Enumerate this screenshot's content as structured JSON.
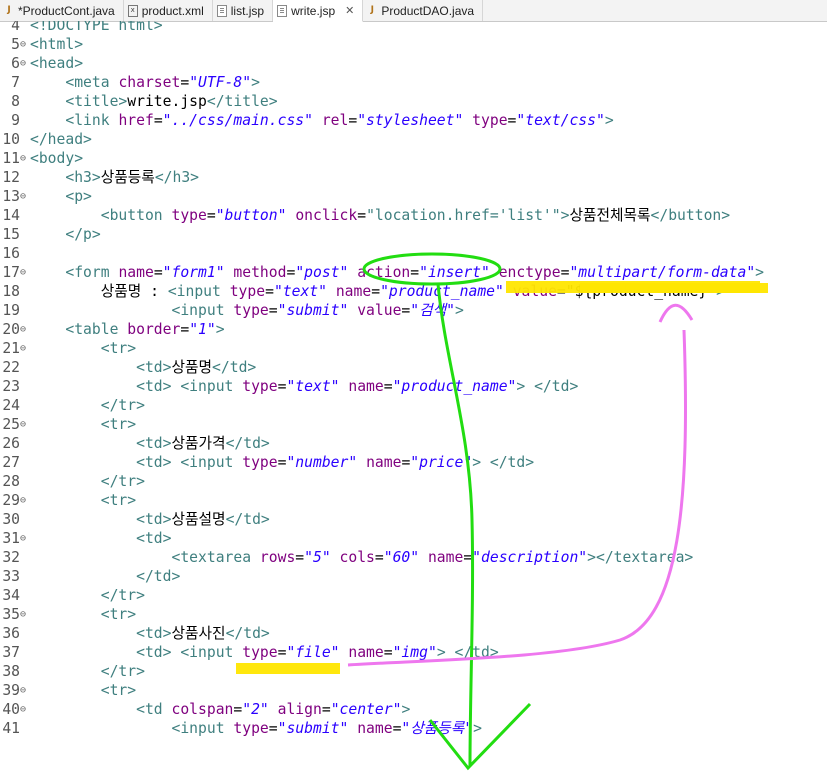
{
  "tabs": [
    {
      "label": "*ProductCont.java",
      "icon": "java-file-icon",
      "active": false
    },
    {
      "label": "product.xml",
      "icon": "xml-file-icon",
      "active": false
    },
    {
      "label": "list.jsp",
      "icon": "jsp-file-icon",
      "active": false
    },
    {
      "label": "write.jsp",
      "icon": "jsp-file-icon",
      "active": true,
      "close": "✕"
    },
    {
      "label": "ProductDAO.java",
      "icon": "java-file-icon",
      "active": false
    }
  ],
  "code_lines": [
    {
      "n": "4",
      "fold": false,
      "parts": [
        [
          "t",
          "<!DOCTYPE html>"
        ]
      ]
    },
    {
      "n": "5",
      "fold": true,
      "parts": [
        [
          "t",
          "<html>"
        ]
      ]
    },
    {
      "n": "6",
      "fold": true,
      "parts": [
        [
          "t",
          "<head>"
        ]
      ]
    },
    {
      "n": "7",
      "fold": false,
      "parts": [
        [
          "k",
          "    "
        ],
        [
          "t",
          "<meta "
        ],
        [
          "a",
          "charset"
        ],
        [
          "k",
          "="
        ],
        [
          "v",
          "\"UTF-8\""
        ],
        [
          "t",
          ">"
        ]
      ]
    },
    {
      "n": "8",
      "fold": false,
      "parts": [
        [
          "k",
          "    "
        ],
        [
          "t",
          "<title>"
        ],
        [
          "k",
          "write.jsp"
        ],
        [
          "t",
          "</title>"
        ]
      ]
    },
    {
      "n": "9",
      "fold": false,
      "parts": [
        [
          "k",
          "    "
        ],
        [
          "t",
          "<link "
        ],
        [
          "a",
          "href"
        ],
        [
          "k",
          "="
        ],
        [
          "v",
          "\"../css/main.css\""
        ],
        [
          "k",
          " "
        ],
        [
          "a",
          "rel"
        ],
        [
          "k",
          "="
        ],
        [
          "v",
          "\"stylesheet\""
        ],
        [
          "k",
          " "
        ],
        [
          "a",
          "type"
        ],
        [
          "k",
          "="
        ],
        [
          "v",
          "\"text/css\""
        ],
        [
          "t",
          ">"
        ]
      ]
    },
    {
      "n": "10",
      "fold": false,
      "parts": [
        [
          "t",
          "</head>"
        ]
      ]
    },
    {
      "n": "11",
      "fold": true,
      "parts": [
        [
          "t",
          "<body>"
        ]
      ]
    },
    {
      "n": "12",
      "fold": false,
      "parts": [
        [
          "k",
          "    "
        ],
        [
          "t",
          "<h3>"
        ],
        [
          "k",
          "상품등록"
        ],
        [
          "t",
          "</h3>"
        ]
      ]
    },
    {
      "n": "13",
      "fold": true,
      "parts": [
        [
          "k",
          "    "
        ],
        [
          "t",
          "<p>"
        ]
      ]
    },
    {
      "n": "14",
      "fold": false,
      "parts": [
        [
          "k",
          "        "
        ],
        [
          "t",
          "<button "
        ],
        [
          "a",
          "type"
        ],
        [
          "k",
          "="
        ],
        [
          "v",
          "\"button\""
        ],
        [
          "k",
          " "
        ],
        [
          "a",
          "onclick"
        ],
        [
          "k",
          "="
        ],
        [
          "t",
          "\"location.href='list'\""
        ],
        [
          "t",
          ">"
        ],
        [
          "k",
          "상품전체목록"
        ],
        [
          "t",
          "</button>"
        ]
      ]
    },
    {
      "n": "15",
      "fold": false,
      "parts": [
        [
          "k",
          "    "
        ],
        [
          "t",
          "</p>"
        ]
      ]
    },
    {
      "n": "16",
      "fold": false,
      "parts": [
        [
          "k",
          ""
        ]
      ]
    },
    {
      "n": "17",
      "fold": true,
      "parts": [
        [
          "k",
          "    "
        ],
        [
          "t",
          "<form "
        ],
        [
          "a",
          "name"
        ],
        [
          "k",
          "="
        ],
        [
          "v",
          "\"form1\""
        ],
        [
          "k",
          " "
        ],
        [
          "a",
          "method"
        ],
        [
          "k",
          "="
        ],
        [
          "v",
          "\"post\""
        ],
        [
          "k",
          " "
        ],
        [
          "a",
          "action"
        ],
        [
          "k",
          "="
        ],
        [
          "v",
          "\"insert\""
        ],
        [
          "k",
          " "
        ],
        [
          "a",
          "enctype"
        ],
        [
          "k",
          "="
        ],
        [
          "v",
          "\"multipart/form-data\""
        ],
        [
          "t",
          ">"
        ]
      ]
    },
    {
      "n": "18",
      "fold": false,
      "parts": [
        [
          "k",
          "        상품명 : "
        ],
        [
          "t",
          "<input "
        ],
        [
          "a",
          "type"
        ],
        [
          "k",
          "="
        ],
        [
          "v",
          "\"text\""
        ],
        [
          "k",
          " "
        ],
        [
          "a",
          "name"
        ],
        [
          "k",
          "="
        ],
        [
          "v",
          "\"product_name\""
        ],
        [
          "k",
          " "
        ],
        [
          "a",
          "value"
        ],
        [
          "k",
          "="
        ],
        [
          "k",
          "\"${product_name}\""
        ],
        [
          "t",
          ">"
        ]
      ]
    },
    {
      "n": "19",
      "fold": false,
      "parts": [
        [
          "k",
          "                "
        ],
        [
          "t",
          "<input "
        ],
        [
          "a",
          "type"
        ],
        [
          "k",
          "="
        ],
        [
          "v",
          "\"submit\""
        ],
        [
          "k",
          " "
        ],
        [
          "a",
          "value"
        ],
        [
          "k",
          "="
        ],
        [
          "v",
          "\"검색\""
        ],
        [
          "t",
          ">"
        ]
      ]
    },
    {
      "n": "20",
      "fold": true,
      "parts": [
        [
          "k",
          "    "
        ],
        [
          "t",
          "<table "
        ],
        [
          "a",
          "border"
        ],
        [
          "k",
          "="
        ],
        [
          "v",
          "\"1\""
        ],
        [
          "t",
          ">"
        ]
      ]
    },
    {
      "n": "21",
      "fold": true,
      "parts": [
        [
          "k",
          "        "
        ],
        [
          "t",
          "<tr>"
        ]
      ]
    },
    {
      "n": "22",
      "fold": false,
      "parts": [
        [
          "k",
          "            "
        ],
        [
          "t",
          "<td>"
        ],
        [
          "k",
          "상품명"
        ],
        [
          "t",
          "</td>"
        ]
      ]
    },
    {
      "n": "23",
      "fold": false,
      "parts": [
        [
          "k",
          "            "
        ],
        [
          "t",
          "<td> <input "
        ],
        [
          "a",
          "type"
        ],
        [
          "k",
          "="
        ],
        [
          "v",
          "\"text\""
        ],
        [
          "k",
          " "
        ],
        [
          "a",
          "name"
        ],
        [
          "k",
          "="
        ],
        [
          "v",
          "\"product_name\""
        ],
        [
          "t",
          "> </td>"
        ]
      ]
    },
    {
      "n": "24",
      "fold": false,
      "parts": [
        [
          "k",
          "        "
        ],
        [
          "t",
          "</tr>"
        ]
      ]
    },
    {
      "n": "25",
      "fold": true,
      "parts": [
        [
          "k",
          "        "
        ],
        [
          "t",
          "<tr>"
        ]
      ]
    },
    {
      "n": "26",
      "fold": false,
      "parts": [
        [
          "k",
          "            "
        ],
        [
          "t",
          "<td>"
        ],
        [
          "k",
          "상품가격"
        ],
        [
          "t",
          "</td>"
        ]
      ]
    },
    {
      "n": "27",
      "fold": false,
      "parts": [
        [
          "k",
          "            "
        ],
        [
          "t",
          "<td> <input "
        ],
        [
          "a",
          "type"
        ],
        [
          "k",
          "="
        ],
        [
          "v",
          "\"number\""
        ],
        [
          "k",
          " "
        ],
        [
          "a",
          "name"
        ],
        [
          "k",
          "="
        ],
        [
          "v",
          "\"price\""
        ],
        [
          "t",
          "> </td>"
        ]
      ]
    },
    {
      "n": "28",
      "fold": false,
      "parts": [
        [
          "k",
          "        "
        ],
        [
          "t",
          "</tr>"
        ]
      ]
    },
    {
      "n": "29",
      "fold": true,
      "parts": [
        [
          "k",
          "        "
        ],
        [
          "t",
          "<tr>"
        ]
      ]
    },
    {
      "n": "30",
      "fold": false,
      "parts": [
        [
          "k",
          "            "
        ],
        [
          "t",
          "<td>"
        ],
        [
          "k",
          "상품설명"
        ],
        [
          "t",
          "</td>"
        ]
      ]
    },
    {
      "n": "31",
      "fold": true,
      "parts": [
        [
          "k",
          "            "
        ],
        [
          "t",
          "<td>"
        ]
      ]
    },
    {
      "n": "32",
      "fold": false,
      "parts": [
        [
          "k",
          "                "
        ],
        [
          "t",
          "<textarea "
        ],
        [
          "a",
          "rows"
        ],
        [
          "k",
          "="
        ],
        [
          "v",
          "\"5\""
        ],
        [
          "k",
          " "
        ],
        [
          "a",
          "cols"
        ],
        [
          "k",
          "="
        ],
        [
          "v",
          "\"60\""
        ],
        [
          "k",
          " "
        ],
        [
          "a",
          "name"
        ],
        [
          "k",
          "="
        ],
        [
          "v",
          "\"description\""
        ],
        [
          "t",
          "></textarea>"
        ]
      ]
    },
    {
      "n": "33",
      "fold": false,
      "parts": [
        [
          "k",
          "            "
        ],
        [
          "t",
          "</td>"
        ]
      ]
    },
    {
      "n": "34",
      "fold": false,
      "parts": [
        [
          "k",
          "        "
        ],
        [
          "t",
          "</tr>"
        ]
      ]
    },
    {
      "n": "35",
      "fold": true,
      "parts": [
        [
          "k",
          "        "
        ],
        [
          "t",
          "<tr>"
        ]
      ]
    },
    {
      "n": "36",
      "fold": false,
      "parts": [
        [
          "k",
          "            "
        ],
        [
          "t",
          "<td>"
        ],
        [
          "k",
          "상품사진"
        ],
        [
          "t",
          "</td>"
        ]
      ]
    },
    {
      "n": "37",
      "fold": false,
      "parts": [
        [
          "k",
          "            "
        ],
        [
          "t",
          "<td> <input "
        ],
        [
          "a",
          "type"
        ],
        [
          "k",
          "="
        ],
        [
          "v",
          "\"file\""
        ],
        [
          "k",
          " "
        ],
        [
          "a",
          "name"
        ],
        [
          "k",
          "="
        ],
        [
          "v",
          "\"img\""
        ],
        [
          "t",
          "> </td>"
        ]
      ]
    },
    {
      "n": "38",
      "fold": false,
      "parts": [
        [
          "k",
          "        "
        ],
        [
          "t",
          "</tr>"
        ]
      ]
    },
    {
      "n": "39",
      "fold": true,
      "parts": [
        [
          "k",
          "        "
        ],
        [
          "t",
          "<tr>"
        ]
      ]
    },
    {
      "n": "40",
      "fold": true,
      "parts": [
        [
          "k",
          "            "
        ],
        [
          "t",
          "<td "
        ],
        [
          "a",
          "colspan"
        ],
        [
          "k",
          "="
        ],
        [
          "v",
          "\"2\""
        ],
        [
          "k",
          " "
        ],
        [
          "a",
          "align"
        ],
        [
          "k",
          "="
        ],
        [
          "v",
          "\"center\""
        ],
        [
          "t",
          ">"
        ]
      ]
    },
    {
      "n": "41",
      "fold": false,
      "parts": [
        [
          "k",
          "                "
        ],
        [
          "t",
          "<input "
        ],
        [
          "a",
          "type"
        ],
        [
          "k",
          "="
        ],
        [
          "v",
          "\"submit\""
        ],
        [
          "k",
          " "
        ],
        [
          "a",
          "name"
        ],
        [
          "k",
          "="
        ],
        [
          "v",
          "\"상품등록\""
        ],
        [
          "t",
          ">"
        ]
      ]
    }
  ],
  "colors": {
    "tag": "#3f7f7f",
    "attribute": "#7f007f",
    "value": "#2a00ff",
    "highlight": "#ffe600",
    "green_annotation": "#22dd11",
    "pink_annotation": "#ee77ee"
  }
}
